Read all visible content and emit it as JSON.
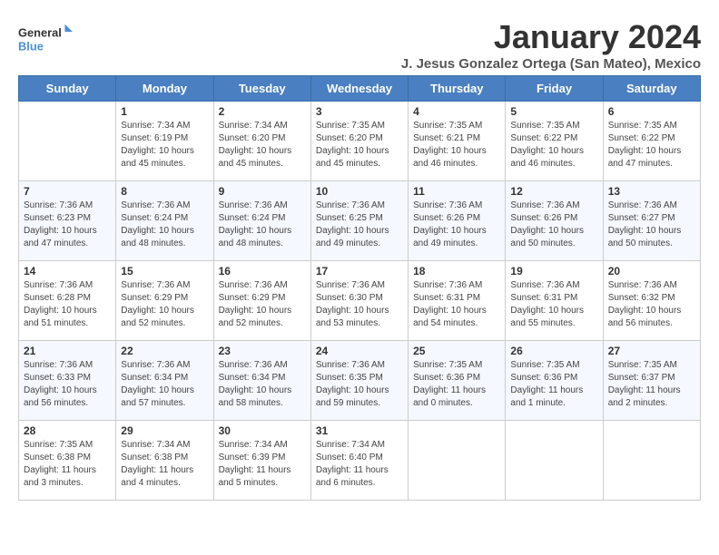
{
  "logo": {
    "text_general": "General",
    "text_blue": "Blue"
  },
  "calendar": {
    "title": "January 2024",
    "subtitle": "J. Jesus Gonzalez Ortega (San Mateo), Mexico"
  },
  "days_of_week": [
    "Sunday",
    "Monday",
    "Tuesday",
    "Wednesday",
    "Thursday",
    "Friday",
    "Saturday"
  ],
  "weeks": [
    [
      {
        "day": "",
        "info": ""
      },
      {
        "day": "1",
        "info": "Sunrise: 7:34 AM\nSunset: 6:19 PM\nDaylight: 10 hours\nand 45 minutes."
      },
      {
        "day": "2",
        "info": "Sunrise: 7:34 AM\nSunset: 6:20 PM\nDaylight: 10 hours\nand 45 minutes."
      },
      {
        "day": "3",
        "info": "Sunrise: 7:35 AM\nSunset: 6:20 PM\nDaylight: 10 hours\nand 45 minutes."
      },
      {
        "day": "4",
        "info": "Sunrise: 7:35 AM\nSunset: 6:21 PM\nDaylight: 10 hours\nand 46 minutes."
      },
      {
        "day": "5",
        "info": "Sunrise: 7:35 AM\nSunset: 6:22 PM\nDaylight: 10 hours\nand 46 minutes."
      },
      {
        "day": "6",
        "info": "Sunrise: 7:35 AM\nSunset: 6:22 PM\nDaylight: 10 hours\nand 47 minutes."
      }
    ],
    [
      {
        "day": "7",
        "info": "Sunrise: 7:36 AM\nSunset: 6:23 PM\nDaylight: 10 hours\nand 47 minutes."
      },
      {
        "day": "8",
        "info": "Sunrise: 7:36 AM\nSunset: 6:24 PM\nDaylight: 10 hours\nand 48 minutes."
      },
      {
        "day": "9",
        "info": "Sunrise: 7:36 AM\nSunset: 6:24 PM\nDaylight: 10 hours\nand 48 minutes."
      },
      {
        "day": "10",
        "info": "Sunrise: 7:36 AM\nSunset: 6:25 PM\nDaylight: 10 hours\nand 49 minutes."
      },
      {
        "day": "11",
        "info": "Sunrise: 7:36 AM\nSunset: 6:26 PM\nDaylight: 10 hours\nand 49 minutes."
      },
      {
        "day": "12",
        "info": "Sunrise: 7:36 AM\nSunset: 6:26 PM\nDaylight: 10 hours\nand 50 minutes."
      },
      {
        "day": "13",
        "info": "Sunrise: 7:36 AM\nSunset: 6:27 PM\nDaylight: 10 hours\nand 50 minutes."
      }
    ],
    [
      {
        "day": "14",
        "info": "Sunrise: 7:36 AM\nSunset: 6:28 PM\nDaylight: 10 hours\nand 51 minutes."
      },
      {
        "day": "15",
        "info": "Sunrise: 7:36 AM\nSunset: 6:29 PM\nDaylight: 10 hours\nand 52 minutes."
      },
      {
        "day": "16",
        "info": "Sunrise: 7:36 AM\nSunset: 6:29 PM\nDaylight: 10 hours\nand 52 minutes."
      },
      {
        "day": "17",
        "info": "Sunrise: 7:36 AM\nSunset: 6:30 PM\nDaylight: 10 hours\nand 53 minutes."
      },
      {
        "day": "18",
        "info": "Sunrise: 7:36 AM\nSunset: 6:31 PM\nDaylight: 10 hours\nand 54 minutes."
      },
      {
        "day": "19",
        "info": "Sunrise: 7:36 AM\nSunset: 6:31 PM\nDaylight: 10 hours\nand 55 minutes."
      },
      {
        "day": "20",
        "info": "Sunrise: 7:36 AM\nSunset: 6:32 PM\nDaylight: 10 hours\nand 56 minutes."
      }
    ],
    [
      {
        "day": "21",
        "info": "Sunrise: 7:36 AM\nSunset: 6:33 PM\nDaylight: 10 hours\nand 56 minutes."
      },
      {
        "day": "22",
        "info": "Sunrise: 7:36 AM\nSunset: 6:34 PM\nDaylight: 10 hours\nand 57 minutes."
      },
      {
        "day": "23",
        "info": "Sunrise: 7:36 AM\nSunset: 6:34 PM\nDaylight: 10 hours\nand 58 minutes."
      },
      {
        "day": "24",
        "info": "Sunrise: 7:36 AM\nSunset: 6:35 PM\nDaylight: 10 hours\nand 59 minutes."
      },
      {
        "day": "25",
        "info": "Sunrise: 7:35 AM\nSunset: 6:36 PM\nDaylight: 11 hours\nand 0 minutes."
      },
      {
        "day": "26",
        "info": "Sunrise: 7:35 AM\nSunset: 6:36 PM\nDaylight: 11 hours\nand 1 minute."
      },
      {
        "day": "27",
        "info": "Sunrise: 7:35 AM\nSunset: 6:37 PM\nDaylight: 11 hours\nand 2 minutes."
      }
    ],
    [
      {
        "day": "28",
        "info": "Sunrise: 7:35 AM\nSunset: 6:38 PM\nDaylight: 11 hours\nand 3 minutes."
      },
      {
        "day": "29",
        "info": "Sunrise: 7:34 AM\nSunset: 6:38 PM\nDaylight: 11 hours\nand 4 minutes."
      },
      {
        "day": "30",
        "info": "Sunrise: 7:34 AM\nSunset: 6:39 PM\nDaylight: 11 hours\nand 5 minutes."
      },
      {
        "day": "31",
        "info": "Sunrise: 7:34 AM\nSunset: 6:40 PM\nDaylight: 11 hours\nand 6 minutes."
      },
      {
        "day": "",
        "info": ""
      },
      {
        "day": "",
        "info": ""
      },
      {
        "day": "",
        "info": ""
      }
    ]
  ]
}
